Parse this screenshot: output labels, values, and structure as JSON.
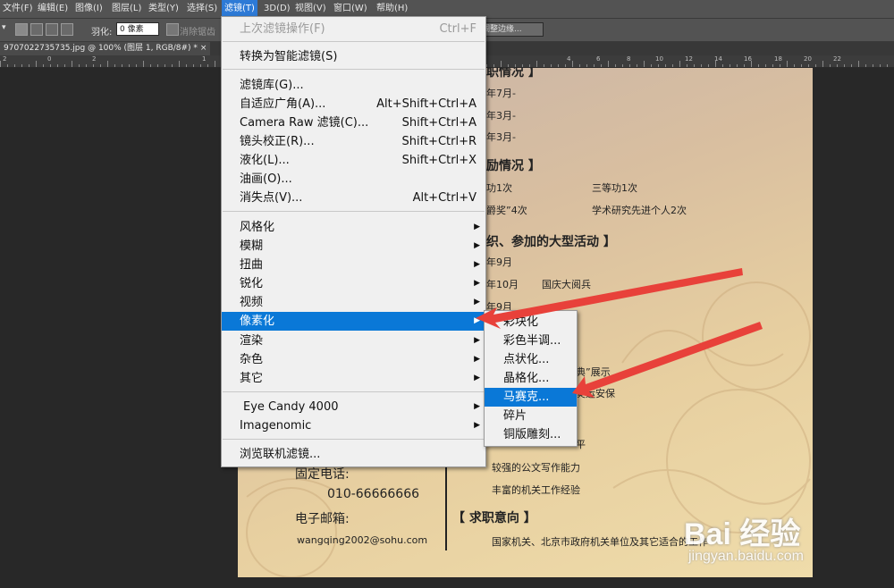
{
  "menubar": {
    "items": [
      "文件(F)",
      "编辑(E)",
      "图像(I)",
      "图层(L)",
      "类型(Y)",
      "选择(S)",
      "滤镜(T)",
      "3D(D)",
      "视图(V)",
      "窗口(W)",
      "帮助(H)"
    ]
  },
  "options": {
    "feather_label": "羽化:",
    "feather_value": "0 像素",
    "antialias_label": "消除锯齿",
    "refine_label": "调整边缘..."
  },
  "document": {
    "tab_title": "9707022735735.jpg @ 100% (图层 1, RGB/8#) *",
    "tab_close": "×"
  },
  "ruler": {
    "labels": [
      "2",
      "0",
      "2",
      "1",
      "4",
      "6",
      "8",
      "10",
      "12",
      "14",
      "16",
      "18",
      "20",
      "22"
    ]
  },
  "filter_menu": {
    "items": [
      {
        "label": "上次滤镜操作(F)",
        "shortcut": "Ctrl+F",
        "disabled": true
      },
      {
        "label": "转换为智能滤镜(S)"
      },
      {
        "label": "滤镜库(G)..."
      },
      {
        "label": "自适应广角(A)...",
        "shortcut": "Alt+Shift+Ctrl+A"
      },
      {
        "label": "Camera Raw 滤镜(C)...",
        "shortcut": "Shift+Ctrl+A"
      },
      {
        "label": "镜头校正(R)...",
        "shortcut": "Shift+Ctrl+R"
      },
      {
        "label": "液化(L)...",
        "shortcut": "Shift+Ctrl+X"
      },
      {
        "label": "油画(O)..."
      },
      {
        "label": "消失点(V)...",
        "shortcut": "Alt+Ctrl+V"
      },
      {
        "label": "风格化",
        "submenu": true
      },
      {
        "label": "模糊",
        "submenu": true
      },
      {
        "label": "扭曲",
        "submenu": true
      },
      {
        "label": "锐化",
        "submenu": true
      },
      {
        "label": "视频",
        "submenu": true
      },
      {
        "label": "像素化",
        "submenu": true,
        "highlighted": true
      },
      {
        "label": "渲染",
        "submenu": true
      },
      {
        "label": "杂色",
        "submenu": true
      },
      {
        "label": "其它",
        "submenu": true
      },
      {
        "label": "Eye Candy 4000",
        "submenu": true
      },
      {
        "label": "Imagenomic",
        "submenu": true
      },
      {
        "label": "浏览联机滤镜..."
      }
    ]
  },
  "pixelate_submenu": {
    "items": [
      {
        "label": "彩块化"
      },
      {
        "label": "彩色半调..."
      },
      {
        "label": "点状化..."
      },
      {
        "label": "晶格化..."
      },
      {
        "label": "马赛克...",
        "highlighted": true
      },
      {
        "label": "碎片"
      },
      {
        "label": "铜版雕刻..."
      }
    ]
  },
  "canvas": {
    "sections": {
      "s1": "职情况 】",
      "s2": "励情况 】",
      "s3": "织、参加的大型活动 】",
      "s4": "【 求职意向 】"
    },
    "lines": {
      "l1": "年7月-",
      "l2": "年3月-",
      "l3": "年3月-",
      "l4": "功1次",
      "l5": "三等功1次",
      "l6": "爵奖”4次",
      "l7": "学术研究先进个人2次",
      "l8": "年9月",
      "l9": "年10月",
      "l10": "国庆大阅兵",
      "l11": "年9月",
      "l12": "典”展示",
      "l13": "奥运安保",
      "l14": "平",
      "l15": "较强的公文写作能力",
      "l16": "丰富的机关工作经验",
      "l17": "国家机关、北京市政府机关单位及其它适合的工作"
    },
    "contact": {
      "phone_label": "固定电话:",
      "phone": "010-66666666",
      "email_label": "电子邮箱:",
      "email": "wangqing2002@sohu.com"
    }
  },
  "watermark": {
    "brand": "Bai 经验",
    "url": "jingyan.baidu.com"
  },
  "colors": {
    "highlight": "#0a78d7",
    "arrow": "#e8413a",
    "menubar": "#535353"
  }
}
